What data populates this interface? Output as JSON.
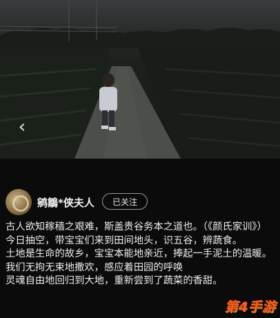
{
  "author": {
    "name": "鹓鶵*侠夫人",
    "follow_label": "已关注"
  },
  "icons": {
    "back": "chevron-left-icon",
    "avatar": "user-avatar"
  },
  "content": {
    "lines": [
      "古人欲知稼穑之艰难，斯盖贵谷务本之道也。（《颜氏家训》）",
      "今日抽空，带宝宝们来到田间地头，识五谷，辨蔬食。",
      "土地是生命的故乡，宝宝本能地亲近，捧起一手泥土的温暖。",
      "我们无拘无束地撒欢，感应着田园的呼唤",
      "灵魂自由地回归到大地，重新尝到了蔬菜的香甜。"
    ]
  },
  "watermark": "第4手游",
  "colors": {
    "background": "#0b0b0c",
    "watermark": "#ff5a1f",
    "text": "#ececec"
  }
}
